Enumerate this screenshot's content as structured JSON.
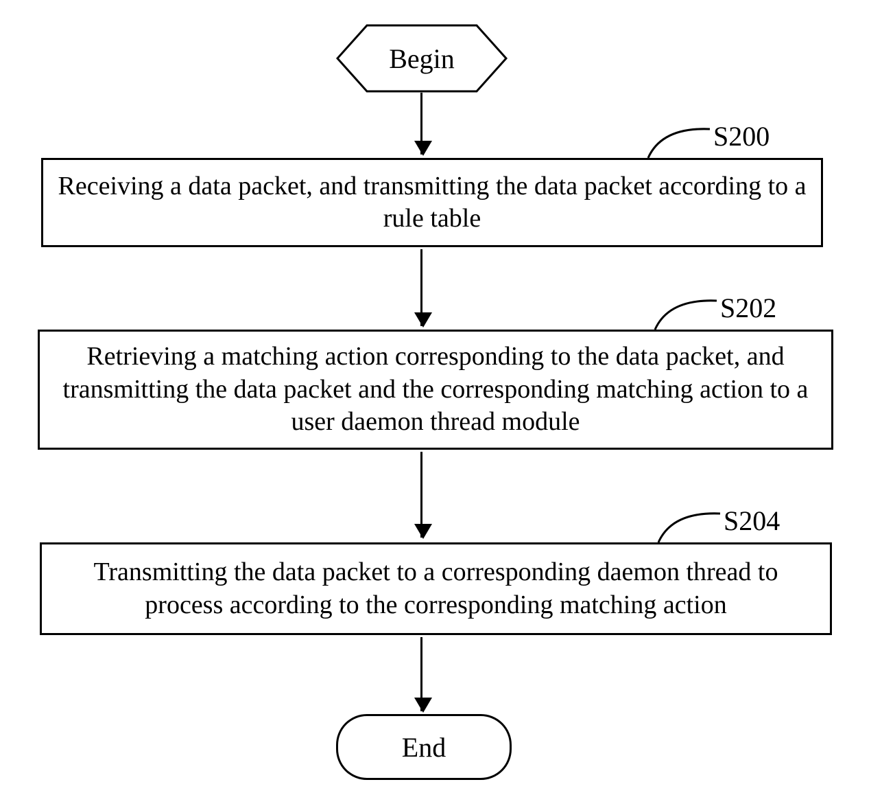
{
  "flow": {
    "begin": "Begin",
    "end": "End",
    "steps": [
      {
        "id": "S200",
        "text": "Receiving a data packet, and transmitting the data packet according to a rule table"
      },
      {
        "id": "S202",
        "text": "Retrieving a matching action corresponding to the data packet, and transmitting the data packet and the corresponding matching action to a user daemon thread module"
      },
      {
        "id": "S204",
        "text": "Transmitting the data packet to a corresponding daemon thread to process according to the corresponding matching action"
      }
    ]
  }
}
